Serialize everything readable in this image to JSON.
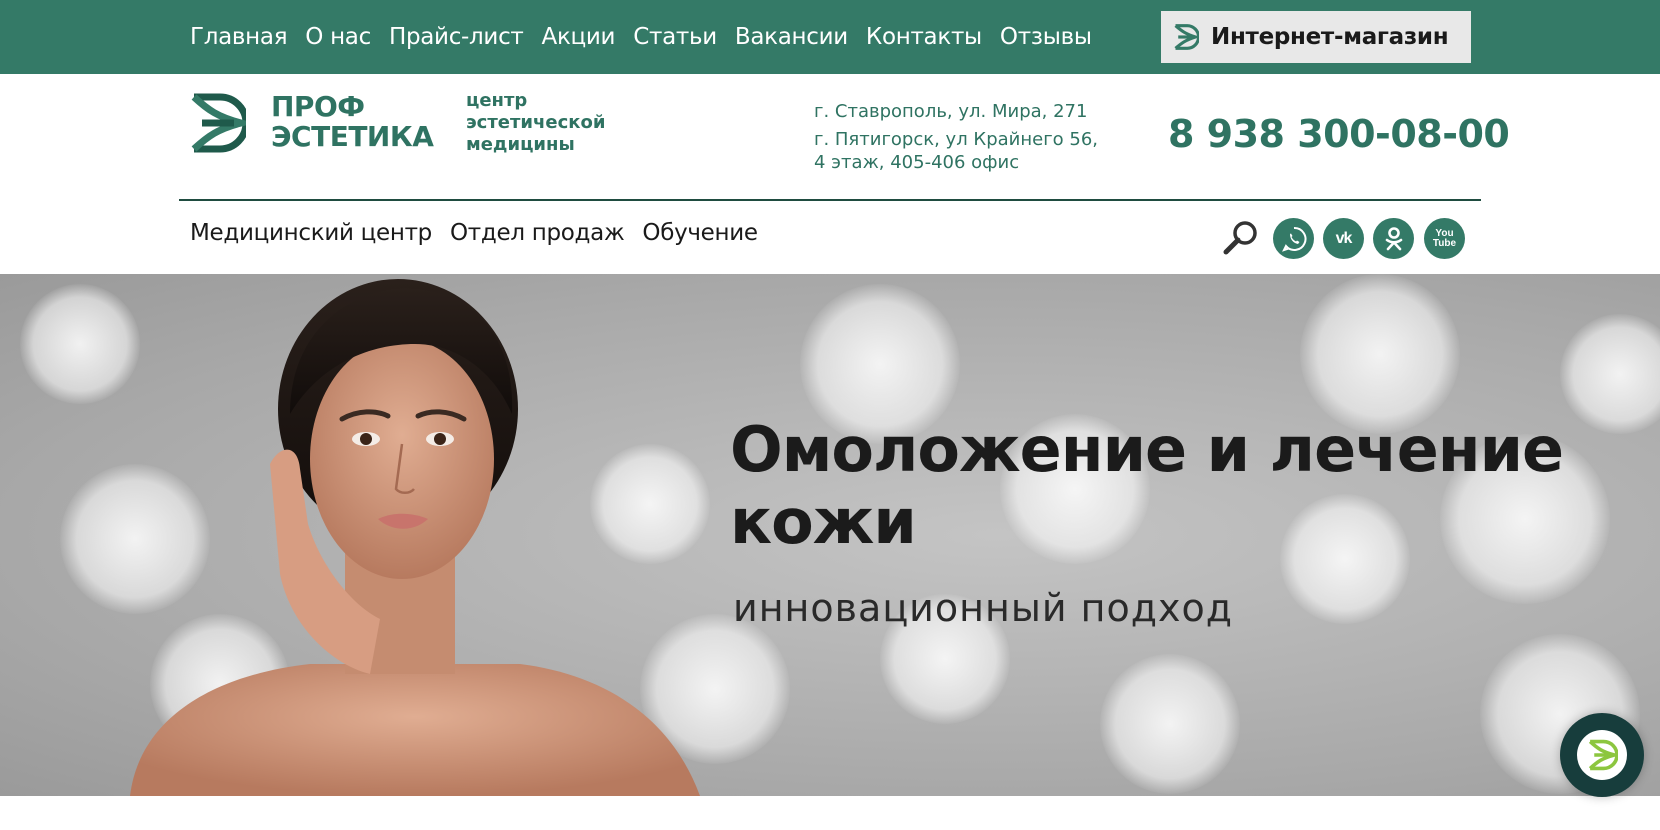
{
  "topnav": {
    "items": [
      {
        "label": "Главная"
      },
      {
        "label": "О нас"
      },
      {
        "label": "Прайс-лист"
      },
      {
        "label": "Акции"
      },
      {
        "label": "Статьи"
      },
      {
        "label": "Вакансии"
      },
      {
        "label": "Контакты"
      },
      {
        "label": "Отзывы"
      }
    ],
    "shop_label": "Интернет-магазин"
  },
  "header": {
    "brand_line1": "ПРОФ",
    "brand_line2": "ЭСТЕТИКА",
    "tagline_line1": "центр",
    "tagline_line2": "эстетической",
    "tagline_line3": "медицины",
    "address1": "г. Ставрополь, ул. Мира, 271",
    "address2_line1": "г. Пятигорск, ул Крайнего 56,",
    "address2_line2": "4 этаж, 405-406 офис",
    "phone": "8 938 300-08-00"
  },
  "subnav": {
    "items": [
      {
        "label": "Медицинский центр"
      },
      {
        "label": "Отдел продаж"
      },
      {
        "label": "Обучение"
      }
    ]
  },
  "social": {
    "icons": [
      "search-icon",
      "whatsapp-icon",
      "vk-icon",
      "odnoklassniki-icon",
      "youtube-icon"
    ],
    "vk_text": "vk",
    "yt_text_1": "You",
    "yt_text_2": "Tube"
  },
  "hero": {
    "title_line1": "Омоложение и лечение",
    "title_line2": "кожи",
    "subtitle": "инновационный подход"
  },
  "colors": {
    "brand_green": "#347a67",
    "text_green": "#2f7362",
    "chat_bg": "#173d3c",
    "accent_lime": "#8cc63f"
  }
}
